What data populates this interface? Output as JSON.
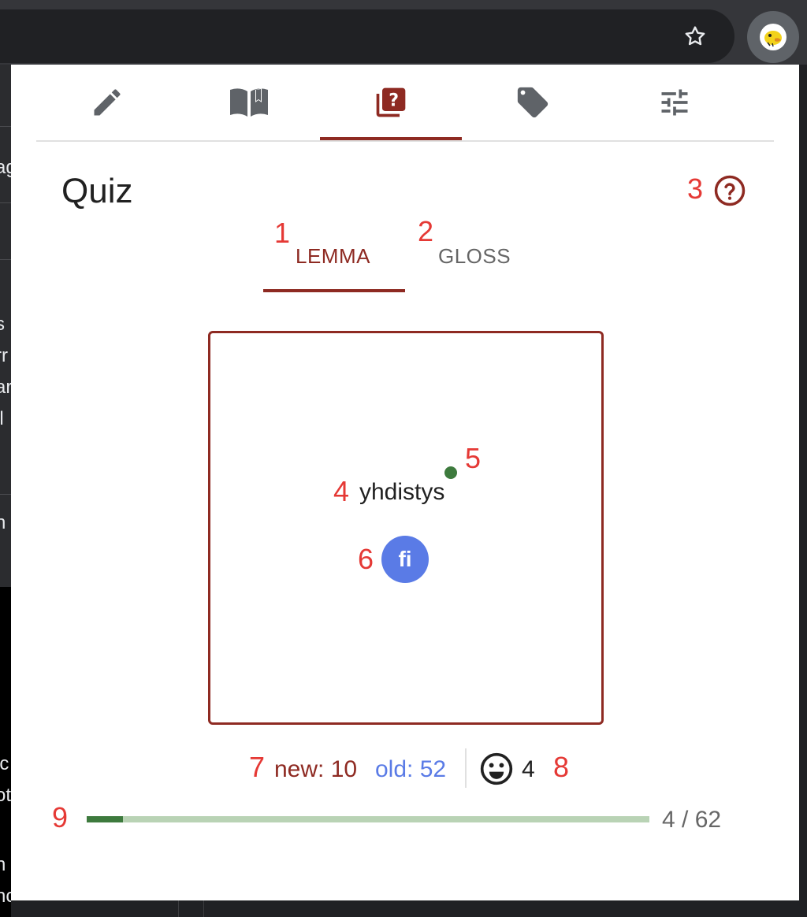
{
  "browser": {
    "bookmark_icon": "star-outline-icon",
    "extension_icon": "duck-logo-icon"
  },
  "background_page": {
    "text_fragments": [
      "ag",
      "s",
      "rr",
      "ar",
      "il",
      "n",
      "ic",
      "ot",
      "n",
      "hct"
    ]
  },
  "popup": {
    "nav_tabs": [
      {
        "icon": "pencil-icon",
        "active": false
      },
      {
        "icon": "book-open-icon",
        "active": false
      },
      {
        "icon": "quiz-cards-icon",
        "active": true
      },
      {
        "icon": "tag-icon",
        "active": false
      },
      {
        "icon": "sliders-icon",
        "active": false
      }
    ],
    "title": "Quiz",
    "help_icon": "help-circle-icon",
    "mode_tabs": [
      {
        "label": "LEMMA",
        "active": true
      },
      {
        "label": "GLOSS",
        "active": false
      }
    ],
    "card": {
      "lemma": "yhdistys",
      "language": "fi",
      "status_color": "#3d7a3d"
    },
    "stats": {
      "new_label": "new: 10",
      "old_label": "old: 52",
      "streak_icon": "smiley-icon",
      "streak_count": "4"
    },
    "progress": {
      "current": 4,
      "total": 62,
      "label": "4 / 62"
    }
  },
  "annotations": [
    "1",
    "2",
    "3",
    "4",
    "5",
    "6",
    "7",
    "8",
    "9"
  ],
  "colors": {
    "accent": "#8e2a22",
    "blue": "#5a7be6",
    "green": "#3d7a3d",
    "annotation": "#e53935"
  }
}
